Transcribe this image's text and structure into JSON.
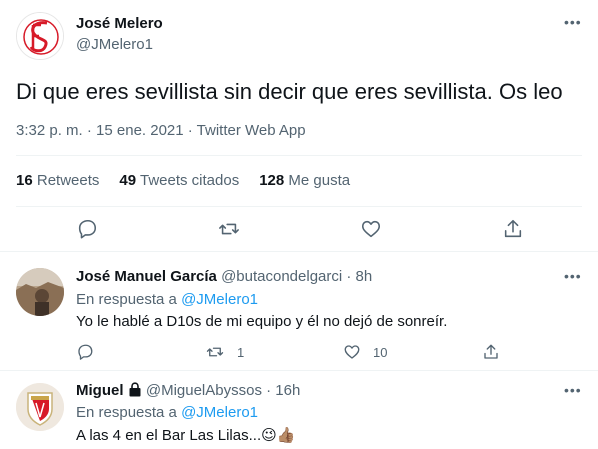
{
  "tweet": {
    "author_name": "José Melero",
    "author_handle": "@JMelero1",
    "text": "Di que eres sevillista sin decir que eres sevillista. Os leo",
    "meta": "3:32 p. m. · 15 ene. 2021 · Twitter Web App",
    "stats": {
      "retweets_count": "16",
      "retweets_label": "Retweets",
      "quotes_count": "49",
      "quotes_label": "Tweets citados",
      "likes_count": "128",
      "likes_label": "Me gusta"
    }
  },
  "replies": [
    {
      "name": "José Manuel García",
      "handle": "@butacondelgarci",
      "time": "· 8h",
      "reply_prefix": "En respuesta a",
      "reply_to": "@JMelero1",
      "text": "Yo le hablé a D10s de mi equipo y él no dejó de sonreír.",
      "retweets": "1",
      "likes": "10"
    },
    {
      "name": "Miguel",
      "handle": "@MiguelAbyssos",
      "time": "· 16h",
      "reply_prefix": "En respuesta a",
      "reply_to": "@JMelero1",
      "text": "A las 4 en el Bar Las Lilas...😉👍🏽"
    }
  ],
  "icons": [
    "more-icon",
    "reply-icon",
    "retweet-icon",
    "like-icon",
    "share-icon",
    "lock-icon"
  ],
  "colors": {
    "link": "#1d9bf0",
    "secondary": "#536471",
    "text": "#0f1419",
    "crest_red": "#d71a28"
  }
}
